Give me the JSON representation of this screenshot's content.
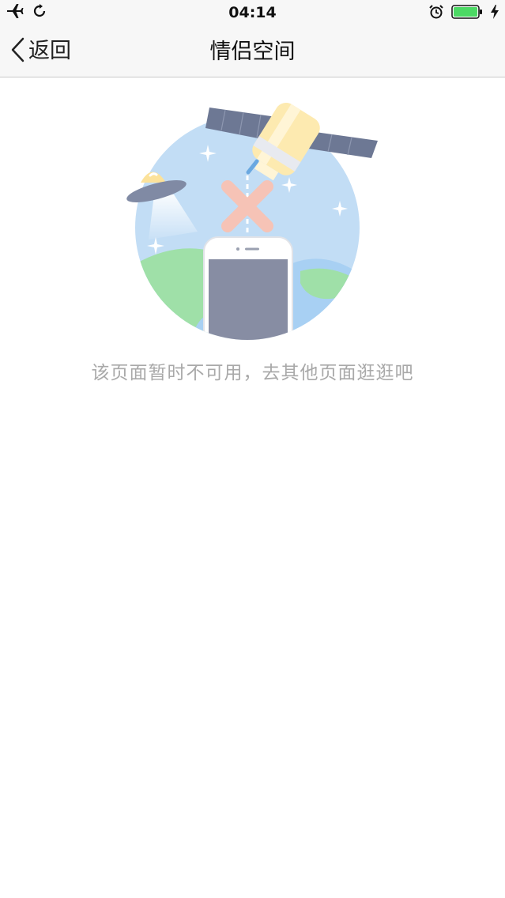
{
  "status_bar": {
    "time": "04:14",
    "icons": [
      "airplane-icon",
      "sync-icon",
      "alarm-icon",
      "battery-icon",
      "charging-icon"
    ],
    "battery_color": "#4cd964"
  },
  "nav": {
    "back_label": "返回",
    "title": "情侣空间"
  },
  "main": {
    "message": "该页面暂时不可用，去其他页面逛逛吧",
    "illustration": {
      "elements": [
        "satellite",
        "ufo",
        "phone",
        "earth",
        "disconnect-x"
      ],
      "colors": {
        "sky": "#c2ddf5",
        "land": "#9fe0a8",
        "ocean": "#a8d0f3",
        "phone_screen": "#878da3",
        "x_mark": "#f6c3b6",
        "solar_panel": "#6d7894",
        "satellite_body": "#fdeab0"
      }
    }
  }
}
